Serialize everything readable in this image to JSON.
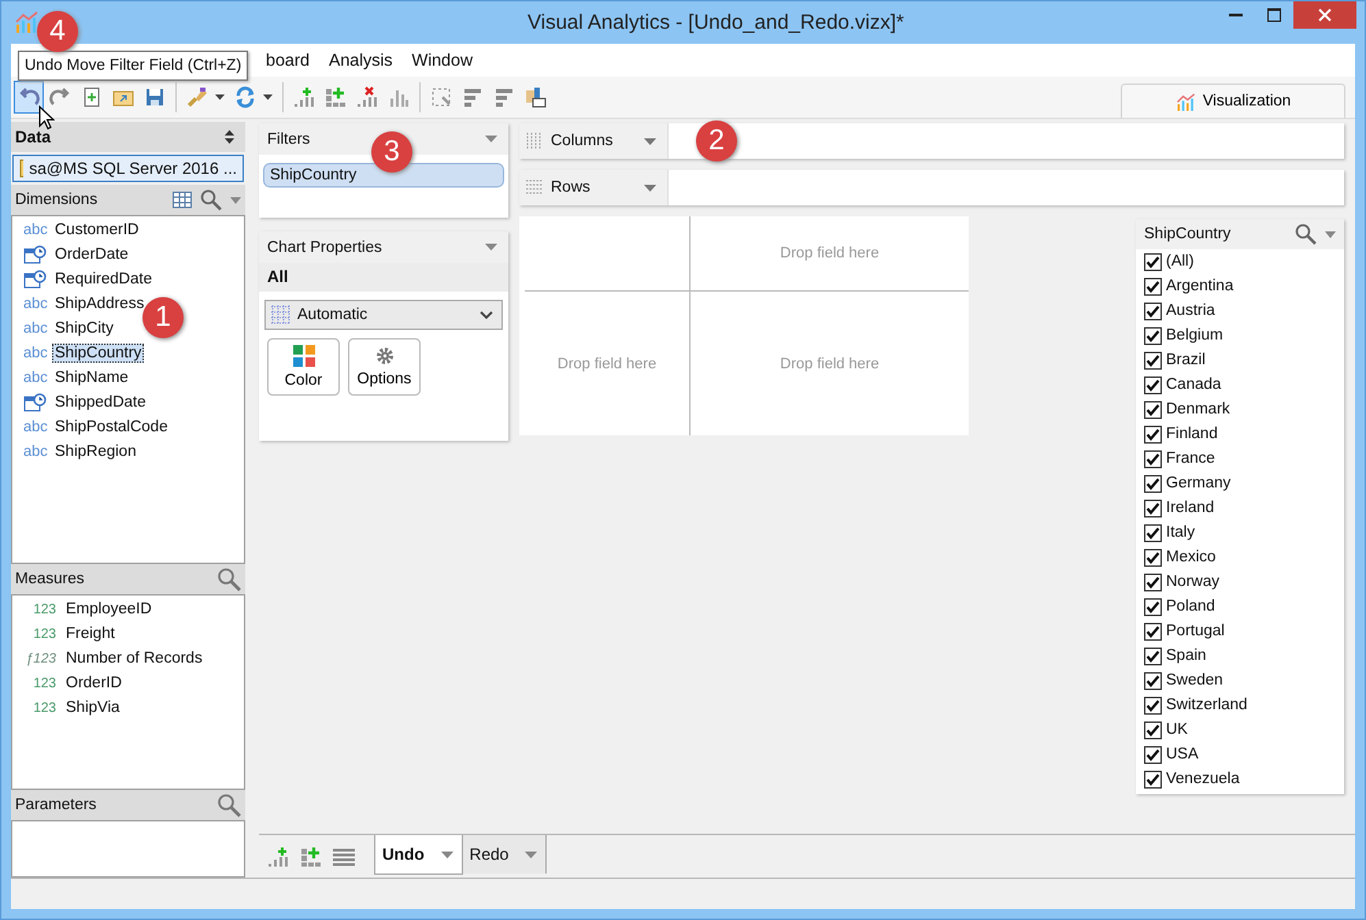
{
  "window": {
    "title": "Visual Analytics - [Undo_and_Redo.vizx]*"
  },
  "menu": [
    {
      "label": "board"
    },
    {
      "label": "Analysis"
    },
    {
      "label": "Window"
    }
  ],
  "tooltip": {
    "text": "Undo Move Filter Field (Ctrl+Z)",
    "callout": "4"
  },
  "toolbar": [
    {
      "kind": "undo",
      "highlighted": true
    },
    {
      "kind": "redo",
      "highlighted": false
    },
    {
      "kind": "new",
      "highlighted": false
    },
    {
      "kind": "open",
      "highlighted": false
    },
    {
      "kind": "save",
      "highlighted": false
    },
    {
      "kind": "separator"
    },
    {
      "kind": "brush",
      "highlighted": false
    },
    {
      "kind": "refresh",
      "highlighted": false
    },
    {
      "kind": "separator"
    },
    {
      "kind": "add-bars",
      "highlighted": false
    },
    {
      "kind": "add-grid",
      "highlighted": false
    },
    {
      "kind": "remove-bars",
      "highlighted": false
    },
    {
      "kind": "bars",
      "highlighted": false
    },
    {
      "kind": "separator"
    },
    {
      "kind": "select",
      "highlighted": false
    },
    {
      "kind": "hbars",
      "highlighted": false
    },
    {
      "kind": "hbars",
      "highlighted": false
    },
    {
      "kind": "image",
      "highlighted": false
    }
  ],
  "view_tabs": [
    {
      "label": "Visualization",
      "selected": true
    }
  ],
  "data_panel": {
    "title": "Data",
    "source": "sa@MS SQL Server 2016 ..."
  },
  "dimensions": {
    "title": "Dimensions",
    "callout": "1",
    "items": [
      {
        "label": "CustomerID",
        "kind": "text",
        "type_label": "abc",
        "selected": false
      },
      {
        "label": "OrderDate",
        "kind": "date",
        "selected": false
      },
      {
        "label": "RequiredDate",
        "kind": "date",
        "selected": false
      },
      {
        "label": "ShipAddress",
        "kind": "text",
        "type_label": "abc",
        "selected": false
      },
      {
        "label": "ShipCity",
        "kind": "text",
        "type_label": "abc",
        "selected": false
      },
      {
        "label": "ShipCountry",
        "kind": "text",
        "type_label": "abc",
        "selected": true
      },
      {
        "label": "ShipName",
        "kind": "text",
        "type_label": "abc",
        "selected": false
      },
      {
        "label": "ShippedDate",
        "kind": "date",
        "selected": false
      },
      {
        "label": "ShipPostalCode",
        "kind": "text",
        "type_label": "abc",
        "selected": false
      },
      {
        "label": "ShipRegion",
        "kind": "text",
        "type_label": "abc",
        "selected": false
      }
    ]
  },
  "measures": {
    "title": "Measures",
    "items": [
      {
        "label": "EmployeeID",
        "kind": "number",
        "type_label": "123"
      },
      {
        "label": "Freight",
        "kind": "number",
        "type_label": "123"
      },
      {
        "label": "Number of Records",
        "kind": "calculated",
        "type_label": "ƒ123"
      },
      {
        "label": "OrderID",
        "kind": "number",
        "type_label": "123"
      },
      {
        "label": "ShipVia",
        "kind": "number",
        "type_label": "123"
      }
    ]
  },
  "parameters": {
    "title": "Parameters"
  },
  "filters": {
    "title": "Filters",
    "callout": "3",
    "fields": [
      "ShipCountry"
    ]
  },
  "chart_properties": {
    "title": "Chart Properties",
    "scope": "All",
    "chart_type": "Automatic",
    "buttons": [
      {
        "label": "Color",
        "kind": "color"
      },
      {
        "label": "Options",
        "kind": "options"
      }
    ]
  },
  "shelves": [
    {
      "label": "Columns",
      "kind": "columns",
      "callout": "2"
    },
    {
      "label": "Rows",
      "kind": "rows"
    }
  ],
  "chart_area": {
    "placeholders": [
      "Drop field here",
      "Drop field here",
      "Drop field here"
    ]
  },
  "filter_card": {
    "title": "ShipCountry",
    "items": [
      {
        "label": "(All)",
        "checked": true
      },
      {
        "label": "Argentina",
        "checked": true
      },
      {
        "label": "Austria",
        "checked": true
      },
      {
        "label": "Belgium",
        "checked": true
      },
      {
        "label": "Brazil",
        "checked": true
      },
      {
        "label": "Canada",
        "checked": true
      },
      {
        "label": "Denmark",
        "checked": true
      },
      {
        "label": "Finland",
        "checked": true
      },
      {
        "label": "France",
        "checked": true
      },
      {
        "label": "Germany",
        "checked": true
      },
      {
        "label": "Ireland",
        "checked": true
      },
      {
        "label": "Italy",
        "checked": true
      },
      {
        "label": "Mexico",
        "checked": true
      },
      {
        "label": "Norway",
        "checked": true
      },
      {
        "label": "Poland",
        "checked": true
      },
      {
        "label": "Portugal",
        "checked": true
      },
      {
        "label": "Spain",
        "checked": true
      },
      {
        "label": "Sweden",
        "checked": true
      },
      {
        "label": "Switzerland",
        "checked": true
      },
      {
        "label": "UK",
        "checked": true
      },
      {
        "label": "USA",
        "checked": true
      },
      {
        "label": "Venezuela",
        "checked": true
      }
    ]
  },
  "sheet_tabs": [
    {
      "label": "Undo",
      "selected": true
    },
    {
      "label": "Redo",
      "selected": false
    }
  ]
}
